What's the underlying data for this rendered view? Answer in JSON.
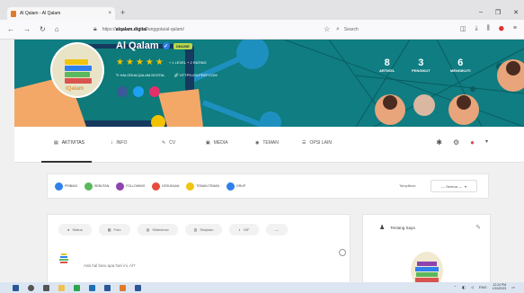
{
  "browser": {
    "tab_title": "Al Qalam - Al Qalam",
    "tab_close": "×",
    "new_tab": "+",
    "url_prefix": "https://",
    "url_domain": "alqalam.digital",
    "url_path": "/anggota/al-qalam/",
    "search_placeholder": "Search"
  },
  "profile": {
    "name": "Al Qalam",
    "online_badge": "ONLINE",
    "rating_text": "+ 1 LEVEL + 2 RATING",
    "link1": "HALODIALQALAM.DIGITAL",
    "link2": "HTTPS://SLPEEF.COM",
    "stats": [
      {
        "num": "8",
        "label": "ARTIKEL"
      },
      {
        "num": "3",
        "label": "PENGIKUT"
      },
      {
        "num": "6",
        "label": "MENGIKUTI"
      }
    ]
  },
  "nav": {
    "items": [
      {
        "label": "AKTIVITAS",
        "icon": "▤"
      },
      {
        "label": "INFO",
        "icon": "ⅰ"
      },
      {
        "label": "CV",
        "icon": "✎"
      },
      {
        "label": "MEDIA",
        "icon": "▣"
      },
      {
        "label": "TEMAN",
        "icon": "◉"
      },
      {
        "label": "OPSI LAIN",
        "icon": "☰"
      }
    ]
  },
  "filters": {
    "chips": [
      {
        "label": "PRIBADI",
        "color": "#2f80ed"
      },
      {
        "label": "SEBUTAN",
        "color": "#5cb85c"
      },
      {
        "label": "FOLLOWING",
        "color": "#8e44ad"
      },
      {
        "label": "KESUKAAN",
        "color": "#e74c3c"
      },
      {
        "label": "TEMAN-TEMAN",
        "color": "#f1c40f"
      },
      {
        "label": "GRUP",
        "color": "#2f80ed"
      }
    ],
    "tampilkan_label": "Tampilkan:",
    "select_value": "— Semua —"
  },
  "composer": {
    "tabs": [
      "Status",
      "Foto",
      "Slideshow",
      "Sisipkan",
      "GIF",
      "—"
    ],
    "prompt": "Ada hal baru apa hari ini, Al?"
  },
  "about": {
    "title": "Tentang Saya"
  },
  "taskbar": {
    "lang": "ENG",
    "time": "12:24 PM",
    "date": "1/15/2023"
  }
}
